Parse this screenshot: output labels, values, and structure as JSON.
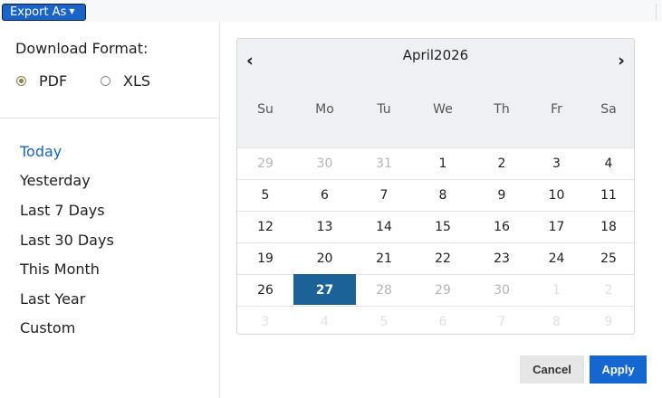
{
  "toolbar": {
    "export_label": "Export As"
  },
  "download": {
    "title": "Download Format:",
    "options": [
      {
        "label": "PDF",
        "checked": true
      },
      {
        "label": "XLS",
        "checked": false
      }
    ]
  },
  "ranges": [
    {
      "label": "Today",
      "active": true
    },
    {
      "label": "Yesterday",
      "active": false
    },
    {
      "label": "Last 7 Days",
      "active": false
    },
    {
      "label": "Last 30 Days",
      "active": false
    },
    {
      "label": "This Month",
      "active": false
    },
    {
      "label": "Last Year",
      "active": false
    },
    {
      "label": "Custom",
      "active": false
    }
  ],
  "calendar": {
    "title": "April2026",
    "prev_icon": "‹",
    "next_icon": "›",
    "weekdays": [
      "Su",
      "Mo",
      "Tu",
      "We",
      "Th",
      "Fr",
      "Sa"
    ],
    "weeks": [
      [
        {
          "d": "29",
          "s": "muted"
        },
        {
          "d": "30",
          "s": "muted"
        },
        {
          "d": "31",
          "s": "muted"
        },
        {
          "d": "1",
          "s": "normal"
        },
        {
          "d": "2",
          "s": "normal"
        },
        {
          "d": "3",
          "s": "normal"
        },
        {
          "d": "4",
          "s": "normal"
        }
      ],
      [
        {
          "d": "5",
          "s": "normal"
        },
        {
          "d": "6",
          "s": "normal"
        },
        {
          "d": "7",
          "s": "normal"
        },
        {
          "d": "8",
          "s": "normal"
        },
        {
          "d": "9",
          "s": "normal"
        },
        {
          "d": "10",
          "s": "normal"
        },
        {
          "d": "11",
          "s": "normal"
        }
      ],
      [
        {
          "d": "12",
          "s": "normal"
        },
        {
          "d": "13",
          "s": "normal"
        },
        {
          "d": "14",
          "s": "normal"
        },
        {
          "d": "15",
          "s": "normal"
        },
        {
          "d": "16",
          "s": "normal"
        },
        {
          "d": "17",
          "s": "normal"
        },
        {
          "d": "18",
          "s": "normal"
        }
      ],
      [
        {
          "d": "19",
          "s": "normal"
        },
        {
          "d": "20",
          "s": "normal"
        },
        {
          "d": "21",
          "s": "normal"
        },
        {
          "d": "22",
          "s": "normal"
        },
        {
          "d": "23",
          "s": "normal"
        },
        {
          "d": "24",
          "s": "normal"
        },
        {
          "d": "25",
          "s": "normal"
        }
      ],
      [
        {
          "d": "26",
          "s": "normal"
        },
        {
          "d": "27",
          "s": "selected"
        },
        {
          "d": "28",
          "s": "muted"
        },
        {
          "d": "29",
          "s": "muted"
        },
        {
          "d": "30",
          "s": "muted"
        },
        {
          "d": "1",
          "s": "faint"
        },
        {
          "d": "2",
          "s": "faint"
        }
      ],
      [
        {
          "d": "3",
          "s": "faint"
        },
        {
          "d": "4",
          "s": "faint"
        },
        {
          "d": "5",
          "s": "faint"
        },
        {
          "d": "6",
          "s": "faint"
        },
        {
          "d": "7",
          "s": "faint"
        },
        {
          "d": "8",
          "s": "faint"
        },
        {
          "d": "9",
          "s": "faint"
        }
      ]
    ]
  },
  "actions": {
    "cancel_label": "Cancel",
    "apply_label": "Apply"
  },
  "colors": {
    "accent": "#1466d0",
    "selected_day": "#1b6298",
    "active_range": "#1466c4",
    "header_bg": "#eef0f3"
  }
}
